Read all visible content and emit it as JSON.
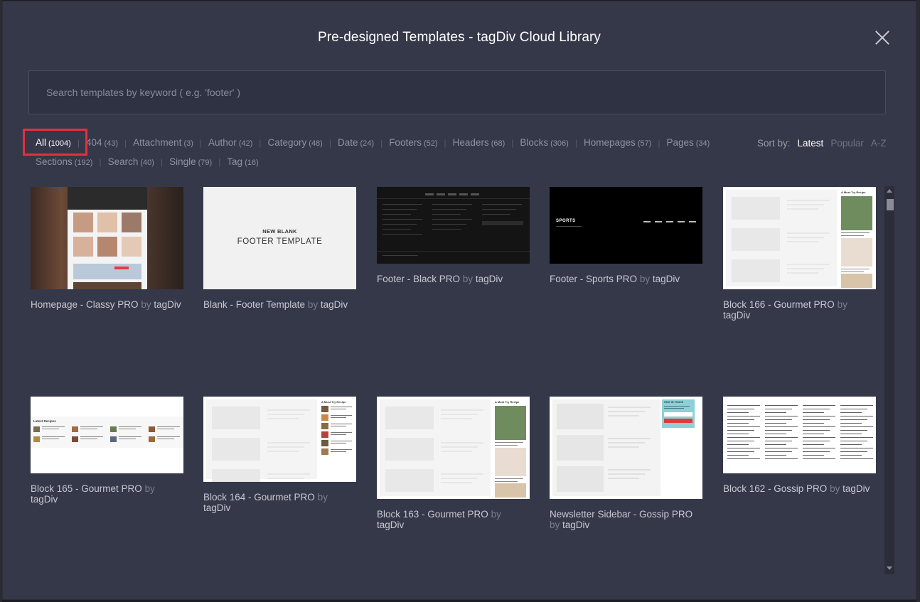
{
  "modal": {
    "title": "Pre-designed Templates - tagDiv Cloud Library"
  },
  "search": {
    "placeholder": "Search templates by keyword ( e.g. 'footer' )"
  },
  "filters": [
    {
      "label": "All",
      "count": "(1004)",
      "active": true
    },
    {
      "label": "404",
      "count": "(43)"
    },
    {
      "label": "Attachment",
      "count": "(3)"
    },
    {
      "label": "Author",
      "count": "(42)"
    },
    {
      "label": "Category",
      "count": "(48)"
    },
    {
      "label": "Date",
      "count": "(24)"
    },
    {
      "label": "Footers",
      "count": "(52)"
    },
    {
      "label": "Headers",
      "count": "(68)"
    },
    {
      "label": "Blocks",
      "count": "(306)"
    },
    {
      "label": "Homepages",
      "count": "(57)"
    },
    {
      "label": "Pages",
      "count": "(34)"
    },
    {
      "label": "Sections",
      "count": "(192)"
    },
    {
      "label": "Search",
      "count": "(40)"
    },
    {
      "label": "Single",
      "count": "(79)"
    },
    {
      "label": "Tag",
      "count": "(16)"
    }
  ],
  "sort": {
    "label": "Sort by:",
    "options": [
      "Latest",
      "Popular",
      "A-Z"
    ],
    "selected": "Latest"
  },
  "templates": [
    {
      "name": "Homepage - Classy PRO",
      "by": "by",
      "author": "tagDiv",
      "thumb_style": "dark-photo"
    },
    {
      "name": "Blank - Footer Template",
      "by": "by",
      "author": "tagDiv",
      "thumb_style": "blank",
      "thumb_text_small": "NEW BLANK",
      "thumb_text_large": "FOOTER TEMPLATE"
    },
    {
      "name": "Footer - Black PRO",
      "by": "by",
      "author": "tagDiv",
      "thumb_style": "black-footer"
    },
    {
      "name": "Footer - Sports PRO",
      "by": "by",
      "author": "tagDiv",
      "thumb_style": "sports-footer",
      "thumb_logo": "SPORTS"
    },
    {
      "name": "Block 166 - Gourmet PRO",
      "by": "by",
      "author": "tagDiv",
      "thumb_style": "light-recipes",
      "thumb_heading": "A Must Try Recipe"
    },
    {
      "name": "Block 165 - Gourmet PRO",
      "by": "by",
      "author": "tagDiv",
      "thumb_style": "latest-recipes",
      "thumb_heading": "Latest Recipes"
    },
    {
      "name": "Block 164 - Gourmet PRO",
      "by": "by",
      "author": "tagDiv",
      "thumb_style": "light-recipes",
      "thumb_heading": "A Must Try Recipe"
    },
    {
      "name": "Block 163 - Gourmet PRO",
      "by": "by",
      "author": "tagDiv",
      "thumb_style": "light-recipes",
      "thumb_heading": "A Must Try Recipe"
    },
    {
      "name": "Newsletter Sidebar - Gossip PRO",
      "by": "by",
      "author": "tagDiv",
      "thumb_style": "newsletter",
      "thumb_heading": "STAY IN TOUCH"
    },
    {
      "name": "Block 162 - Gossip PRO",
      "by": "by",
      "author": "tagDiv",
      "thumb_style": "text-columns"
    }
  ],
  "colors": {
    "modal_bg": "#353849",
    "accent_highlight": "#e4313a",
    "newsletter_red": "#e03a3a",
    "newsletter_teal": "#8ed0d6"
  }
}
